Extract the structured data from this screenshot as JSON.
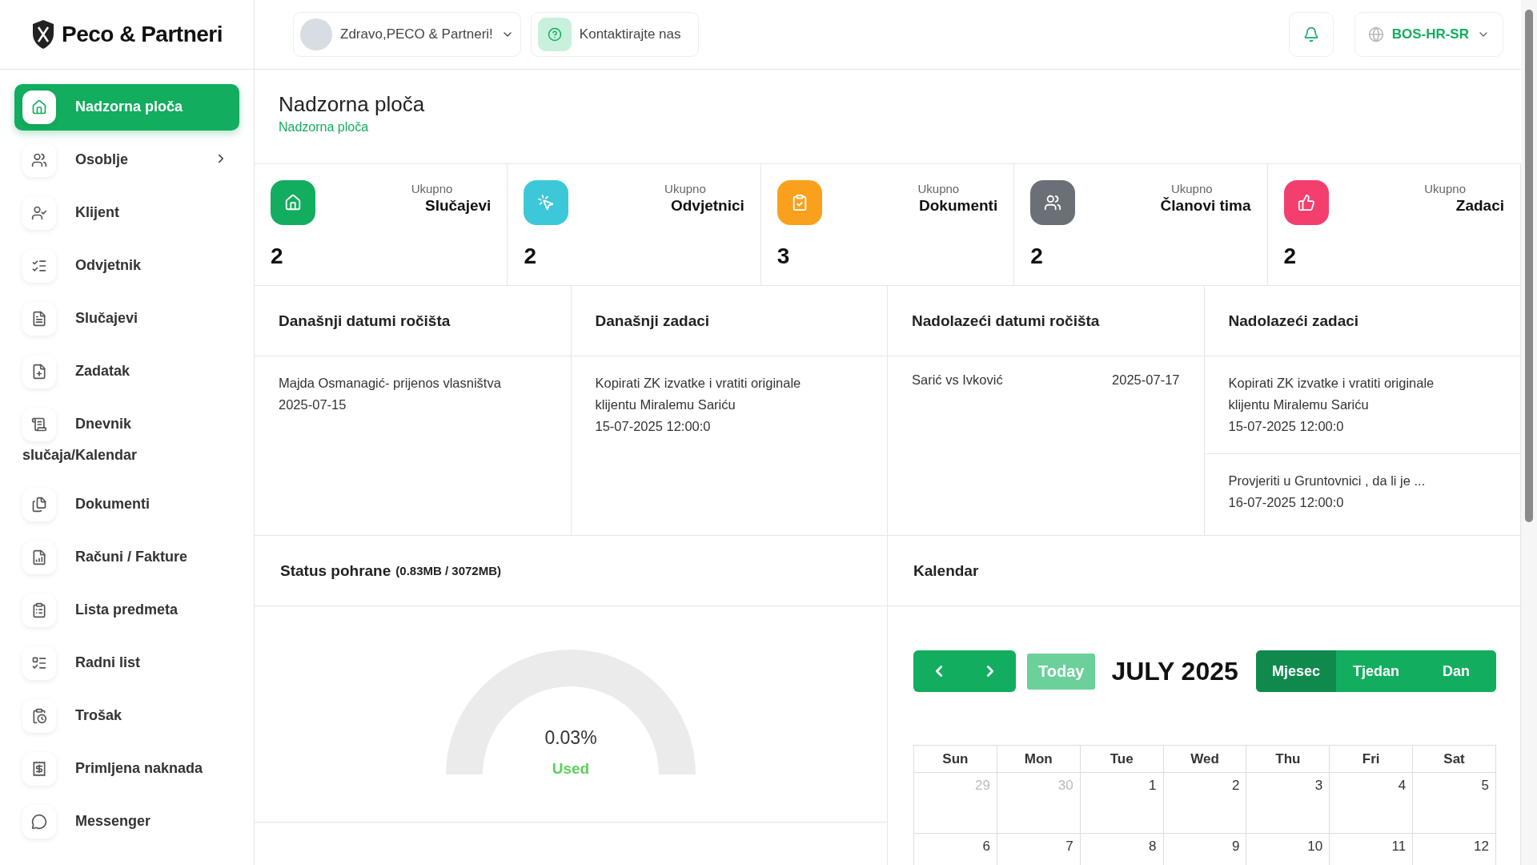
{
  "brand": {
    "name": "Peco & Partneri"
  },
  "header": {
    "greeting": "Zdravo,PECO & Partneri!",
    "contact": "Kontaktirajte nas",
    "language": "BOS-HR-SR"
  },
  "sidebar": {
    "items": [
      {
        "label": "Nadzorna ploča",
        "selected": true
      },
      {
        "label": "Osoblje",
        "selected": false,
        "expanded": false
      },
      {
        "label": "Klijent",
        "selected": false
      },
      {
        "label": "Odvjetnik",
        "selected": false
      },
      {
        "label": "Slučajevi",
        "selected": false
      },
      {
        "label": "Zadatak",
        "selected": false
      },
      {
        "label": "Dnevnik slučaja/Kalendar",
        "selected": false
      },
      {
        "label": "Dokumenti",
        "selected": false
      },
      {
        "label": "Računi / Fakture",
        "selected": false
      },
      {
        "label": "Lista predmeta",
        "selected": false
      },
      {
        "label": "Radni list",
        "selected": false
      },
      {
        "label": "Trošak",
        "selected": false
      },
      {
        "label": "Primljena naknada",
        "selected": false
      },
      {
        "label": "Messenger",
        "selected": false
      }
    ]
  },
  "page": {
    "title": "Nadzorna ploča",
    "breadcrumb": "Nadzorna ploča"
  },
  "stats": [
    {
      "caption": "Ukupno",
      "label": "Slučajevi",
      "value": "2",
      "color": "#12ad5f"
    },
    {
      "caption": "Ukupno",
      "label": "Odvjetnici",
      "value": "2",
      "color": "#3cc8d8"
    },
    {
      "caption": "Ukupno",
      "label": "Dokumenti",
      "value": "3",
      "color": "#f9a11c"
    },
    {
      "caption": "Ukupno",
      "label": "Članovi tima",
      "value": "2",
      "color": "#6b6f76"
    },
    {
      "caption": "Ukupno",
      "label": "Zadaci",
      "value": "2",
      "color": "#f43f6e"
    }
  ],
  "panels": [
    {
      "title": "Današnji datumi ročišta",
      "entries": [
        {
          "lines": [
            "Majda Osmanagić- prijenos vlasništva",
            "2025-07-15"
          ]
        }
      ]
    },
    {
      "title": "Današnji zadaci",
      "entries": [
        {
          "lines": [
            "Kopirati ZK izvatke i vratiti originale klijentu Miralemu Sariću",
            "15-07-2025 12:00:0"
          ]
        }
      ]
    },
    {
      "title": "Nadolazeći datumi ročišta",
      "entries": [
        {
          "name": "Sarić vs Ivković",
          "date": "2025-07-17"
        }
      ]
    },
    {
      "title": "Nadolazeći zadaci",
      "entries": [
        {
          "lines": [
            "Kopirati ZK izvatke i vratiti originale klijentu Miralemu Sariću",
            "15-07-2025 12:00:0"
          ]
        },
        {
          "lines": [
            "Provjeriti u Gruntovnici , da li je ...",
            "16-07-2025 12:00:0"
          ]
        }
      ]
    }
  ],
  "storage": {
    "title": "Status pohrane",
    "usage": "(0.83MB / 3072MB)",
    "percent": "0.03%",
    "caption": "Used"
  },
  "calendar": {
    "title": "Kalendar",
    "today": "Today",
    "month": "JULY 2025",
    "views": [
      {
        "label": "Mjesec",
        "selected": true
      },
      {
        "label": "Tjedan",
        "selected": false
      },
      {
        "label": "Dan",
        "selected": false
      }
    ],
    "weekdays": [
      "Sun",
      "Mon",
      "Tue",
      "Wed",
      "Thu",
      "Fri",
      "Sat"
    ],
    "weeks": [
      [
        {
          "day": "29",
          "other_month": true
        },
        {
          "day": "30",
          "other_month": true
        },
        {
          "day": "1",
          "other_month": false
        },
        {
          "day": "2",
          "other_month": false
        },
        {
          "day": "3",
          "other_month": false
        },
        {
          "day": "4",
          "other_month": false
        },
        {
          "day": "5",
          "other_month": false
        }
      ],
      [
        {
          "day": "6",
          "other_month": false
        },
        {
          "day": "7",
          "other_month": false
        },
        {
          "day": "8",
          "other_month": false
        },
        {
          "day": "9",
          "other_month": false
        },
        {
          "day": "10",
          "other_month": false
        },
        {
          "day": "11",
          "other_month": false
        },
        {
          "day": "12",
          "other_month": false
        }
      ]
    ]
  }
}
